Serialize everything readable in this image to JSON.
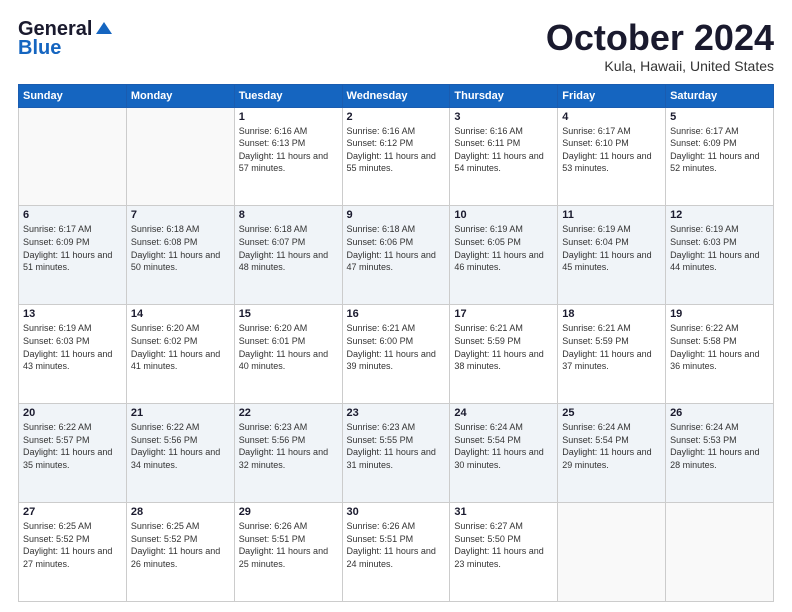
{
  "header": {
    "logo_line1": "General",
    "logo_line2": "Blue",
    "month": "October 2024",
    "location": "Kula, Hawaii, United States"
  },
  "weekdays": [
    "Sunday",
    "Monday",
    "Tuesday",
    "Wednesday",
    "Thursday",
    "Friday",
    "Saturday"
  ],
  "weeks": [
    [
      {
        "day": "",
        "info": ""
      },
      {
        "day": "",
        "info": ""
      },
      {
        "day": "1",
        "info": "Sunrise: 6:16 AM\nSunset: 6:13 PM\nDaylight: 11 hours and 57 minutes."
      },
      {
        "day": "2",
        "info": "Sunrise: 6:16 AM\nSunset: 6:12 PM\nDaylight: 11 hours and 55 minutes."
      },
      {
        "day": "3",
        "info": "Sunrise: 6:16 AM\nSunset: 6:11 PM\nDaylight: 11 hours and 54 minutes."
      },
      {
        "day": "4",
        "info": "Sunrise: 6:17 AM\nSunset: 6:10 PM\nDaylight: 11 hours and 53 minutes."
      },
      {
        "day": "5",
        "info": "Sunrise: 6:17 AM\nSunset: 6:09 PM\nDaylight: 11 hours and 52 minutes."
      }
    ],
    [
      {
        "day": "6",
        "info": "Sunrise: 6:17 AM\nSunset: 6:09 PM\nDaylight: 11 hours and 51 minutes."
      },
      {
        "day": "7",
        "info": "Sunrise: 6:18 AM\nSunset: 6:08 PM\nDaylight: 11 hours and 50 minutes."
      },
      {
        "day": "8",
        "info": "Sunrise: 6:18 AM\nSunset: 6:07 PM\nDaylight: 11 hours and 48 minutes."
      },
      {
        "day": "9",
        "info": "Sunrise: 6:18 AM\nSunset: 6:06 PM\nDaylight: 11 hours and 47 minutes."
      },
      {
        "day": "10",
        "info": "Sunrise: 6:19 AM\nSunset: 6:05 PM\nDaylight: 11 hours and 46 minutes."
      },
      {
        "day": "11",
        "info": "Sunrise: 6:19 AM\nSunset: 6:04 PM\nDaylight: 11 hours and 45 minutes."
      },
      {
        "day": "12",
        "info": "Sunrise: 6:19 AM\nSunset: 6:03 PM\nDaylight: 11 hours and 44 minutes."
      }
    ],
    [
      {
        "day": "13",
        "info": "Sunrise: 6:19 AM\nSunset: 6:03 PM\nDaylight: 11 hours and 43 minutes."
      },
      {
        "day": "14",
        "info": "Sunrise: 6:20 AM\nSunset: 6:02 PM\nDaylight: 11 hours and 41 minutes."
      },
      {
        "day": "15",
        "info": "Sunrise: 6:20 AM\nSunset: 6:01 PM\nDaylight: 11 hours and 40 minutes."
      },
      {
        "day": "16",
        "info": "Sunrise: 6:21 AM\nSunset: 6:00 PM\nDaylight: 11 hours and 39 minutes."
      },
      {
        "day": "17",
        "info": "Sunrise: 6:21 AM\nSunset: 5:59 PM\nDaylight: 11 hours and 38 minutes."
      },
      {
        "day": "18",
        "info": "Sunrise: 6:21 AM\nSunset: 5:59 PM\nDaylight: 11 hours and 37 minutes."
      },
      {
        "day": "19",
        "info": "Sunrise: 6:22 AM\nSunset: 5:58 PM\nDaylight: 11 hours and 36 minutes."
      }
    ],
    [
      {
        "day": "20",
        "info": "Sunrise: 6:22 AM\nSunset: 5:57 PM\nDaylight: 11 hours and 35 minutes."
      },
      {
        "day": "21",
        "info": "Sunrise: 6:22 AM\nSunset: 5:56 PM\nDaylight: 11 hours and 34 minutes."
      },
      {
        "day": "22",
        "info": "Sunrise: 6:23 AM\nSunset: 5:56 PM\nDaylight: 11 hours and 32 minutes."
      },
      {
        "day": "23",
        "info": "Sunrise: 6:23 AM\nSunset: 5:55 PM\nDaylight: 11 hours and 31 minutes."
      },
      {
        "day": "24",
        "info": "Sunrise: 6:24 AM\nSunset: 5:54 PM\nDaylight: 11 hours and 30 minutes."
      },
      {
        "day": "25",
        "info": "Sunrise: 6:24 AM\nSunset: 5:54 PM\nDaylight: 11 hours and 29 minutes."
      },
      {
        "day": "26",
        "info": "Sunrise: 6:24 AM\nSunset: 5:53 PM\nDaylight: 11 hours and 28 minutes."
      }
    ],
    [
      {
        "day": "27",
        "info": "Sunrise: 6:25 AM\nSunset: 5:52 PM\nDaylight: 11 hours and 27 minutes."
      },
      {
        "day": "28",
        "info": "Sunrise: 6:25 AM\nSunset: 5:52 PM\nDaylight: 11 hours and 26 minutes."
      },
      {
        "day": "29",
        "info": "Sunrise: 6:26 AM\nSunset: 5:51 PM\nDaylight: 11 hours and 25 minutes."
      },
      {
        "day": "30",
        "info": "Sunrise: 6:26 AM\nSunset: 5:51 PM\nDaylight: 11 hours and 24 minutes."
      },
      {
        "day": "31",
        "info": "Sunrise: 6:27 AM\nSunset: 5:50 PM\nDaylight: 11 hours and 23 minutes."
      },
      {
        "day": "",
        "info": ""
      },
      {
        "day": "",
        "info": ""
      }
    ]
  ]
}
